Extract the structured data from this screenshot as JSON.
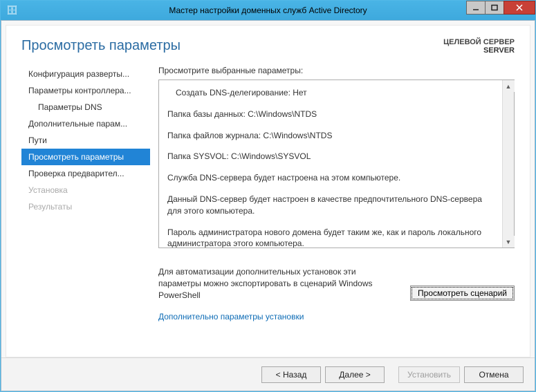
{
  "titlebar": {
    "title": "Мастер настройки доменных служб Active Directory"
  },
  "header": {
    "page_title": "Просмотреть параметры",
    "target_label": "ЦЕЛЕВОЙ СЕРВЕР",
    "target_value": "SERVER"
  },
  "steps": [
    {
      "label": "Конфигурация разверты...",
      "indent": false,
      "state": "normal"
    },
    {
      "label": "Параметры контроллера...",
      "indent": false,
      "state": "normal"
    },
    {
      "label": "Параметры DNS",
      "indent": true,
      "state": "normal"
    },
    {
      "label": "Дополнительные парам...",
      "indent": false,
      "state": "normal"
    },
    {
      "label": "Пути",
      "indent": false,
      "state": "normal"
    },
    {
      "label": "Просмотреть параметры",
      "indent": false,
      "state": "selected"
    },
    {
      "label": "Проверка предварител...",
      "indent": false,
      "state": "normal"
    },
    {
      "label": "Установка",
      "indent": false,
      "state": "disabled"
    },
    {
      "label": "Результаты",
      "indent": false,
      "state": "disabled"
    }
  ],
  "main": {
    "instruction": "Просмотрите выбранные параметры:",
    "review_lines": [
      "Создать DNS-делегирование: Нет",
      "Папка базы данных: C:\\Windows\\NTDS",
      "Папка файлов журнала: C:\\Windows\\NTDS",
      "Папка SYSVOL: C:\\Windows\\SYSVOL",
      "Служба DNS-сервера будет настроена на этом компьютере.",
      "Данный DNS-сервер будет настроен в качестве предпочтительного DNS-сервера для этого компьютера.",
      "Пароль администратора нового домена будет таким же, как и пароль локального администратора этого компьютера."
    ],
    "footer_text": "Для автоматизации дополнительных установок эти параметры можно экспортировать в сценарий Windows PowerShell",
    "view_script_btn": "Просмотреть сценарий",
    "more_link": "Дополнительно параметры установки"
  },
  "buttons": {
    "back": "< Назад",
    "next": "Далее >",
    "install": "Установить",
    "cancel": "Отмена"
  }
}
